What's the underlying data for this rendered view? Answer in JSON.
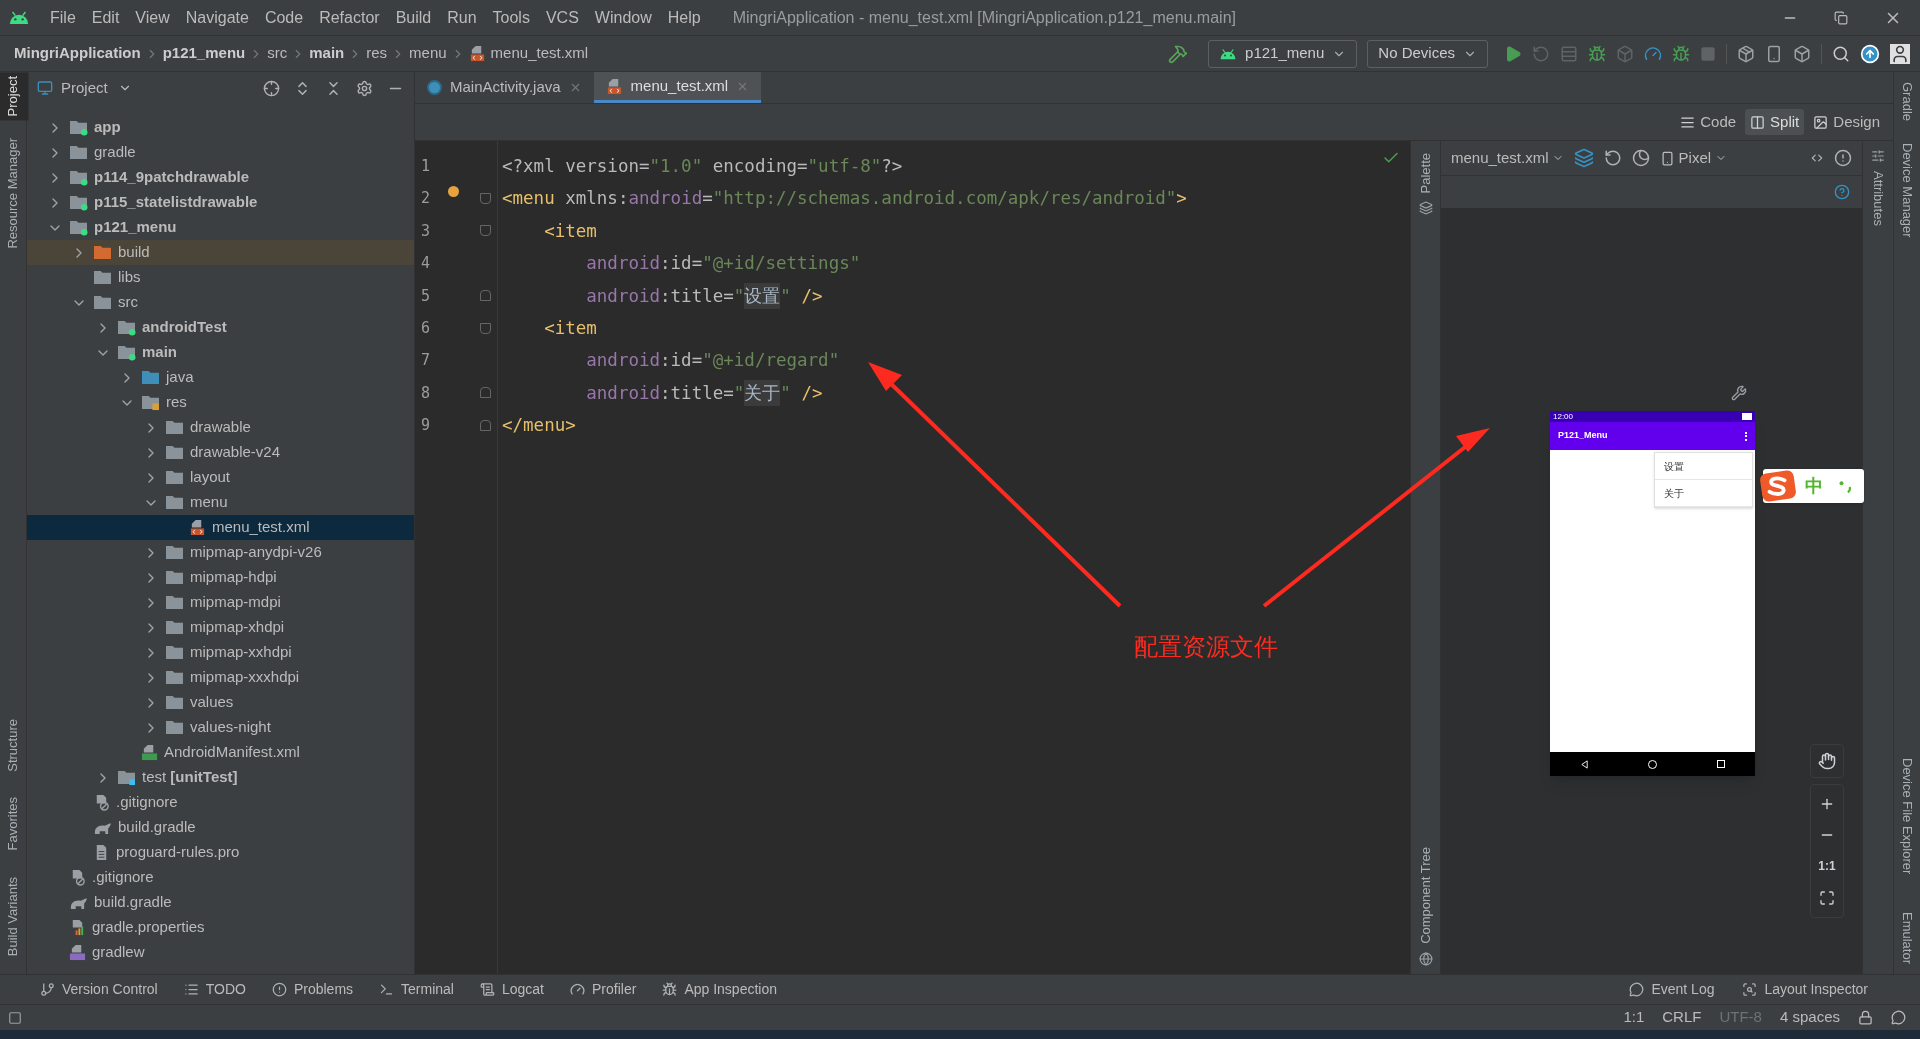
{
  "window": {
    "title": "MingriApplication - menu_test.xml [MingriApplication.p121_menu.main]",
    "menu": [
      "File",
      "Edit",
      "View",
      "Navigate",
      "Code",
      "Refactor",
      "Build",
      "Run",
      "Tools",
      "VCS",
      "Window",
      "Help"
    ]
  },
  "breadcrumb": [
    {
      "label": "MingriApplication",
      "kind": "module"
    },
    {
      "label": "p121_menu",
      "kind": "module"
    },
    {
      "label": "src",
      "kind": "folder"
    },
    {
      "label": "main",
      "kind": "module"
    },
    {
      "label": "res",
      "kind": "folder"
    },
    {
      "label": "menu",
      "kind": "folder"
    },
    {
      "label": "menu_test.xml",
      "kind": "xml-file"
    }
  ],
  "toolbar": {
    "run_config": "p121_menu",
    "device": "No Devices"
  },
  "left_stripe": [
    {
      "label": "Project",
      "selected": true,
      "kind": "top"
    },
    {
      "label": "Resource Manager",
      "selected": false,
      "kind": "top"
    },
    {
      "label": "Structure",
      "selected": false,
      "kind": "bottom"
    },
    {
      "label": "Favorites",
      "selected": false,
      "kind": "bottom"
    },
    {
      "label": "Build Variants",
      "selected": false,
      "kind": "bottom"
    }
  ],
  "project_panel": {
    "title": "Project",
    "tree": [
      {
        "label": "app",
        "kind": "module",
        "expanded": false,
        "selected": false
      },
      {
        "label": "gradle",
        "kind": "folder",
        "expanded": false,
        "selected": false
      },
      {
        "label": "p114_9patchdrawable",
        "kind": "module",
        "expanded": false,
        "selected": false
      },
      {
        "label": "p115_statelistdrawable",
        "kind": "module",
        "expanded": false,
        "selected": false
      },
      {
        "label": "p121_menu",
        "kind": "module",
        "expanded": true,
        "selected": false,
        "children": [
          {
            "label": "build",
            "kind": "build-folder",
            "expanded": false,
            "selected": false
          },
          {
            "label": "libs",
            "kind": "folder",
            "selected": false
          },
          {
            "label": "src",
            "kind": "folder",
            "expanded": true,
            "selected": false,
            "children": [
              {
                "label": "androidTest",
                "kind": "module",
                "expanded": false,
                "selected": false
              },
              {
                "label": "main",
                "kind": "module",
                "expanded": true,
                "selected": false,
                "children": [
                  {
                    "label": "java",
                    "kind": "source-folder",
                    "expanded": false,
                    "selected": false
                  },
                  {
                    "label": "res",
                    "kind": "res-folder",
                    "expanded": true,
                    "selected": false,
                    "children": [
                      {
                        "label": "drawable",
                        "kind": "folder",
                        "expanded": false,
                        "selected": false
                      },
                      {
                        "label": "drawable-v24",
                        "kind": "folder",
                        "expanded": false,
                        "selected": false
                      },
                      {
                        "label": "layout",
                        "kind": "folder",
                        "expanded": false,
                        "selected": false
                      },
                      {
                        "label": "menu",
                        "kind": "folder",
                        "expanded": true,
                        "selected": false,
                        "children": [
                          {
                            "label": "menu_test.xml",
                            "kind": "xml-file",
                            "selected": true
                          }
                        ]
                      },
                      {
                        "label": "mipmap-anydpi-v26",
                        "kind": "folder",
                        "expanded": false,
                        "selected": false
                      },
                      {
                        "label": "mipmap-hdpi",
                        "kind": "folder",
                        "expanded": false,
                        "selected": false
                      },
                      {
                        "label": "mipmap-mdpi",
                        "kind": "folder",
                        "expanded": false,
                        "selected": false
                      },
                      {
                        "label": "mipmap-xhdpi",
                        "kind": "folder",
                        "expanded": false,
                        "selected": false
                      },
                      {
                        "label": "mipmap-xxhdpi",
                        "kind": "folder",
                        "expanded": false,
                        "selected": false
                      },
                      {
                        "label": "mipmap-xxxhdpi",
                        "kind": "folder",
                        "expanded": false,
                        "selected": false
                      },
                      {
                        "label": "values",
                        "kind": "folder",
                        "expanded": false,
                        "selected": false
                      },
                      {
                        "label": "values-night",
                        "kind": "folder",
                        "expanded": false,
                        "selected": false
                      }
                    ]
                  },
                  {
                    "label": "AndroidManifest.xml",
                    "kind": "manifest",
                    "selected": false
                  }
                ]
              },
              {
                "label": "test **[unitTest]**",
                "kind": "test-folder",
                "expanded": false,
                "selected": false
              }
            ]
          },
          {
            "label": ".gitignore",
            "kind": "ignore-file",
            "selected": false
          },
          {
            "label": "build.gradle",
            "kind": "gradle-file",
            "selected": false
          },
          {
            "label": "proguard-rules.pro",
            "kind": "text-file",
            "selected": false
          }
        ]
      },
      {
        "label": ".gitignore",
        "kind": "ignore-file",
        "selected": false
      },
      {
        "label": "build.gradle",
        "kind": "gradle-file",
        "selected": false
      },
      {
        "label": "gradle.properties",
        "kind": "properties-file",
        "selected": false
      },
      {
        "label": "gradlew",
        "kind": "script-file",
        "selected": false
      }
    ]
  },
  "editor": {
    "tabs": [
      {
        "label": "MainActivity.java",
        "kind": "java",
        "selected": false
      },
      {
        "label": "menu_test.xml",
        "kind": "xml",
        "selected": true
      }
    ],
    "view_modes": [
      {
        "label": "Code",
        "kind": "code",
        "selected": false
      },
      {
        "label": "Split",
        "kind": "split",
        "selected": true
      },
      {
        "label": "Design",
        "kind": "design",
        "selected": false
      }
    ],
    "lines": [
      {
        "number": "1",
        "kind": "plain",
        "bulb": false,
        "tokens": [
          {
            "text": "<?xml version=",
            "kind": "plain"
          },
          {
            "text": "\"1.0\"",
            "kind": "string"
          },
          {
            "text": " encoding=",
            "kind": "plain"
          },
          {
            "text": "\"utf-8\"",
            "kind": "string"
          },
          {
            "text": "?>",
            "kind": "plain"
          }
        ]
      },
      {
        "number": "2",
        "kind": "fold-start",
        "bulb": true,
        "tokens": [
          {
            "text": "<menu",
            "kind": "tag"
          },
          {
            "text": " xmlns:",
            "kind": "attr"
          },
          {
            "text": "android",
            "kind": "ns"
          },
          {
            "text": "=",
            "kind": "attr"
          },
          {
            "text": "\"http://schemas.android.com/apk/res/android\"",
            "kind": "string"
          },
          {
            "text": ">",
            "kind": "tag"
          }
        ]
      },
      {
        "number": "3",
        "kind": "fold-start",
        "bulb": false,
        "tokens": [
          {
            "text": "    <item",
            "kind": "tag"
          }
        ]
      },
      {
        "number": "4",
        "kind": "plain",
        "bulb": false,
        "tokens": [
          {
            "text": "        android",
            "kind": "ns"
          },
          {
            "text": ":id=",
            "kind": "attr"
          },
          {
            "text": "\"@+id/settings\"",
            "kind": "string"
          }
        ]
      },
      {
        "number": "5",
        "kind": "fold-end",
        "bulb": false,
        "tokens": [
          {
            "text": "        android",
            "kind": "ns"
          },
          {
            "text": ":title=",
            "kind": "attr"
          },
          {
            "text": "\"",
            "kind": "string"
          },
          {
            "text": "设置",
            "kind": "cjk"
          },
          {
            "text": "\"",
            "kind": "string"
          },
          {
            "text": " />",
            "kind": "tag"
          }
        ]
      },
      {
        "number": "6",
        "kind": "fold-start",
        "bulb": false,
        "tokens": [
          {
            "text": "    <item",
            "kind": "tag"
          }
        ]
      },
      {
        "number": "7",
        "kind": "plain",
        "bulb": false,
        "tokens": [
          {
            "text": "        android",
            "kind": "ns"
          },
          {
            "text": ":id=",
            "kind": "attr"
          },
          {
            "text": "\"@+id/regard\"",
            "kind": "string"
          }
        ]
      },
      {
        "number": "8",
        "kind": "fold-end",
        "bulb": false,
        "tokens": [
          {
            "text": "        android",
            "kind": "ns"
          },
          {
            "text": ":title=",
            "kind": "attr"
          },
          {
            "text": "\"",
            "kind": "string"
          },
          {
            "text": "关于",
            "kind": "cjk"
          },
          {
            "text": "\"",
            "kind": "string"
          },
          {
            "text": " />",
            "kind": "tag"
          }
        ]
      },
      {
        "number": "9",
        "kind": "fold-end",
        "bulb": false,
        "tokens": [
          {
            "text": "</menu>",
            "kind": "tag"
          }
        ]
      }
    ]
  },
  "palette_stripe": [
    {
      "label": "Palette",
      "kind": "palette"
    },
    {
      "label": "Component Tree",
      "kind": "tree"
    }
  ],
  "design": {
    "file": "menu_test.xml",
    "device": "Pixel",
    "zoom_reset": "1:1",
    "preview": {
      "time": "12:00",
      "app_title": "P121_Menu",
      "menu_items": [
        "设置",
        "关于"
      ]
    }
  },
  "attributes_stripe": [
    "Attributes"
  ],
  "right_stripe": [
    {
      "label": "Gradle",
      "kind": "top"
    },
    {
      "label": "Device Manager",
      "kind": "top"
    },
    {
      "label": "Device File Explorer",
      "kind": "bottom"
    },
    {
      "label": "Emulator",
      "kind": "bottom"
    }
  ],
  "ime": {
    "label": "中"
  },
  "bottom_tools": {
    "left": [
      {
        "label": "Version Control",
        "kind": "vcs"
      },
      {
        "label": "TODO",
        "kind": "todo"
      },
      {
        "label": "Problems",
        "kind": "problems"
      },
      {
        "label": "Terminal",
        "kind": "terminal"
      },
      {
        "label": "Logcat",
        "kind": "logcat"
      },
      {
        "label": "Profiler",
        "kind": "profiler"
      },
      {
        "label": "App Inspection",
        "kind": "inspection"
      }
    ],
    "right": [
      {
        "label": "Event Log",
        "kind": "event"
      },
      {
        "label": "Layout Inspector",
        "kind": "layout"
      }
    ]
  },
  "status_bar": [
    {
      "text": "1:1",
      "disabled": false
    },
    {
      "text": "CRLF",
      "disabled": false
    },
    {
      "text": "UTF-8",
      "disabled": true
    },
    {
      "text": "4 spaces",
      "disabled": false
    }
  ],
  "annotation": {
    "text": "配置资源文件"
  }
}
